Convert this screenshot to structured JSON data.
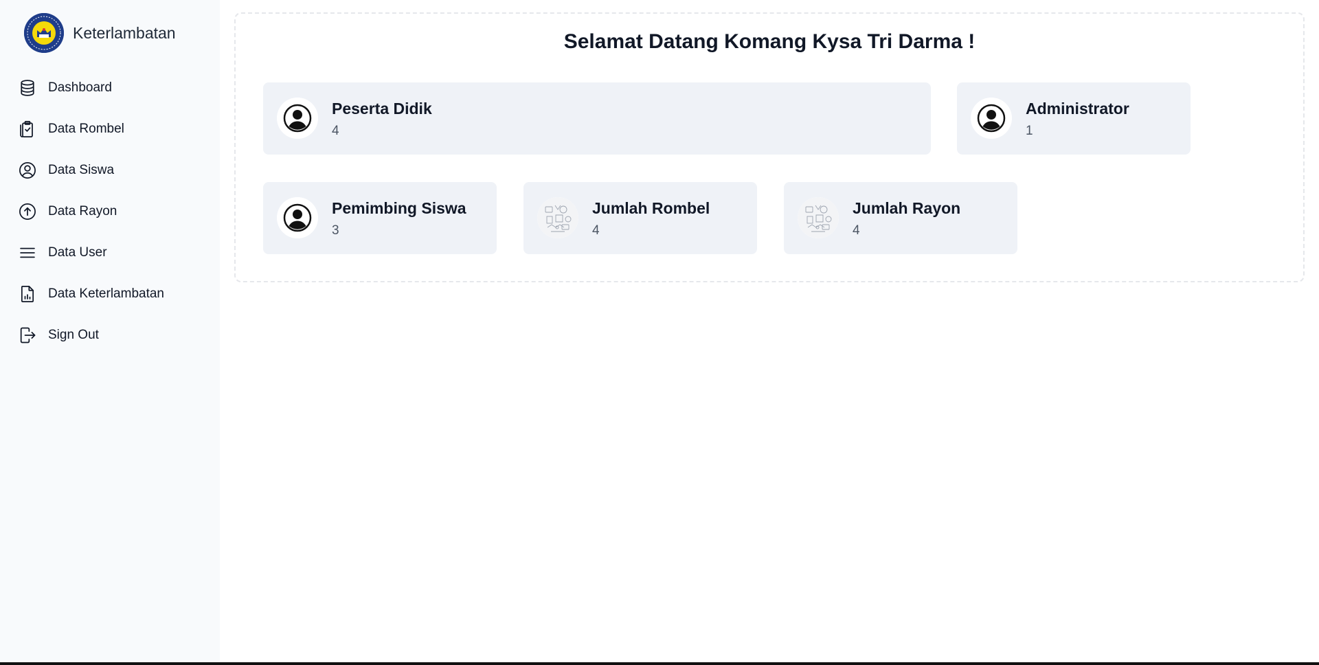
{
  "brand": {
    "name": "Keterlambatan",
    "logo_icon": "school-emblem-icon"
  },
  "sidebar": {
    "items": [
      {
        "label": "Dashboard",
        "icon": "database-icon"
      },
      {
        "label": "Data Rombel",
        "icon": "clipboard-icon"
      },
      {
        "label": "Data Siswa",
        "icon": "user-circle-icon"
      },
      {
        "label": "Data Rayon",
        "icon": "arrow-up-circle-icon"
      },
      {
        "label": "Data User",
        "icon": "menu-icon"
      },
      {
        "label": "Data Keterlambatan",
        "icon": "report-icon"
      },
      {
        "label": "Sign Out",
        "icon": "sign-out-icon"
      }
    ]
  },
  "main": {
    "welcome": "Selamat Datang Komang Kysa Tri Darma !",
    "cards": [
      {
        "title": "Peserta Didik",
        "value": "4",
        "icon": "user-avatar-icon"
      },
      {
        "title": "Administrator",
        "value": "1",
        "icon": "user-avatar-icon"
      },
      {
        "title": "Pemimbing Siswa",
        "value": "3",
        "icon": "user-avatar-icon"
      },
      {
        "title": "Jumlah Rombel",
        "value": "4",
        "icon": "doodle-illustration-icon"
      },
      {
        "title": "Jumlah Rayon",
        "value": "4",
        "icon": "doodle-illustration-icon"
      }
    ]
  },
  "colors": {
    "sidebar_bg": "#f8fafc",
    "card_bg": "#eff2f7",
    "logo_blue": "#1f3d8a",
    "logo_yellow": "#f5d90a"
  }
}
